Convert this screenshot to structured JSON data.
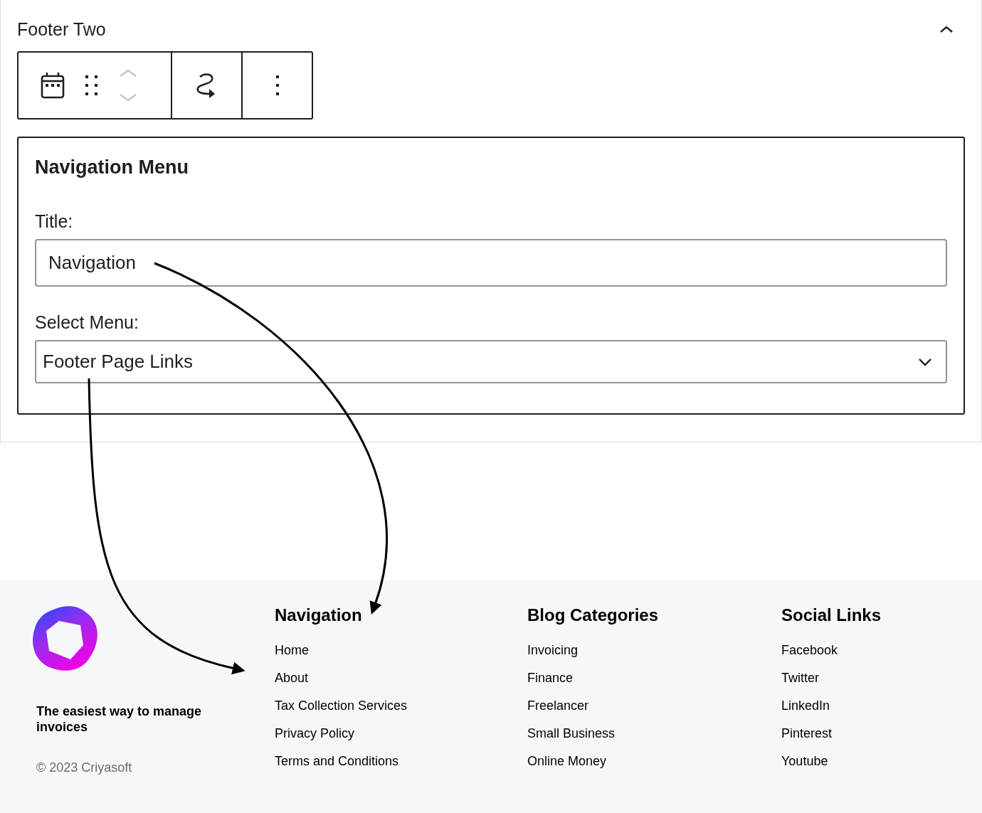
{
  "panel": {
    "title": "Footer Two",
    "expanded": true
  },
  "widget": {
    "title": "Navigation Menu",
    "fields": [
      {
        "kind": "text",
        "label": "Title:",
        "value": "Navigation"
      },
      {
        "kind": "select",
        "label": "Select Menu:",
        "value": "Footer Page Links"
      }
    ]
  },
  "footer": {
    "tagline": "The easiest way to manage invoices",
    "copyright": "© 2023 Criyasoft",
    "columns": [
      {
        "heading": "Navigation",
        "links": [
          "Home",
          "About",
          "Tax Collection Services",
          "Privacy Policy",
          "Terms and Conditions"
        ]
      },
      {
        "heading": "Blog Categories",
        "links": [
          "Invoicing",
          "Finance",
          "Freelancer",
          "Small Business",
          "Online Money"
        ]
      },
      {
        "heading": "Social Links",
        "links": [
          "Facebook",
          "Twitter",
          "LinkedIn",
          "Pinterest",
          "Youtube"
        ]
      }
    ]
  }
}
